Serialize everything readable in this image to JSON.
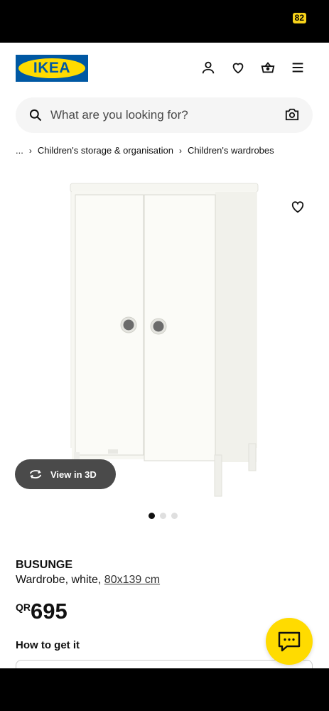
{
  "status_bar": {
    "battery": "82"
  },
  "header": {
    "logo_text": "IKEA"
  },
  "search": {
    "placeholder": "What are you looking for?"
  },
  "breadcrumb": {
    "items": [
      "...",
      "Children's storage & organisation",
      "Children's wardrobes"
    ]
  },
  "gallery": {
    "view_3d_label": "View in 3D",
    "dots_total": 3,
    "dots_active_index": 0
  },
  "product": {
    "name": "BUSUNGE",
    "description_prefix": "Wardrobe, white, ",
    "size": "80x139 cm",
    "currency": "QR",
    "price": "695",
    "how_to_get": "How to get it"
  },
  "colors": {
    "brand_blue": "#0058a3",
    "brand_yellow": "#ffdb00",
    "dark_pill": "#4a4a4a"
  }
}
